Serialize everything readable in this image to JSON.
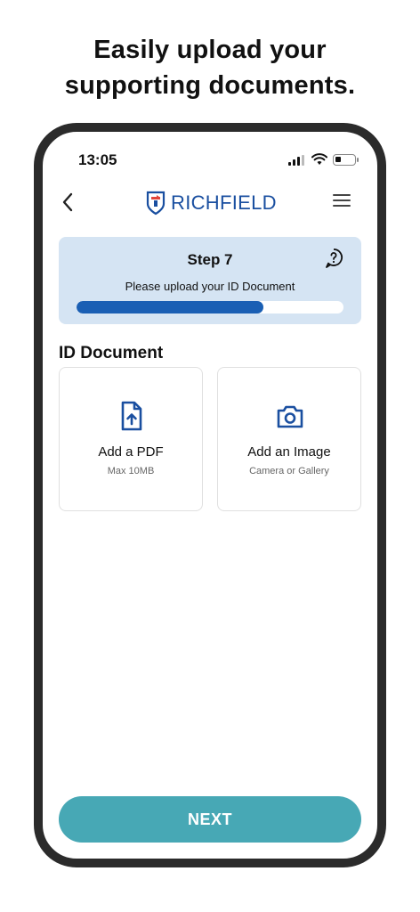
{
  "headline": {
    "line1": "Easily upload your",
    "line2": "supporting documents."
  },
  "status_bar": {
    "time": "13:05",
    "icons": [
      "signal-icon",
      "wifi-icon",
      "battery-icon"
    ]
  },
  "nav": {
    "back_icon": "chevron-left-icon",
    "logo_text": "RICHFIELD",
    "menu_icon": "hamburger-menu-icon"
  },
  "step_card": {
    "title": "Step 7",
    "subtitle": "Please upload your ID Document",
    "help_icon": "help-icon",
    "progress": 0.7
  },
  "section": {
    "title": "ID Document"
  },
  "upload_options": [
    {
      "label": "Add a PDF",
      "sub": "Max 10MB",
      "icon": "file-upload-icon"
    },
    {
      "label": "Add an Image",
      "sub": "Camera or Gallery",
      "icon": "camera-icon"
    }
  ],
  "next_button": {
    "label": "NEXT"
  },
  "colors": {
    "brand_blue": "#1a4fa0",
    "progress_fill": "#1a5fb4",
    "step_card_bg": "#d5e4f3",
    "next_button_bg": "#47a8b5",
    "logo_red": "#e2453a"
  }
}
